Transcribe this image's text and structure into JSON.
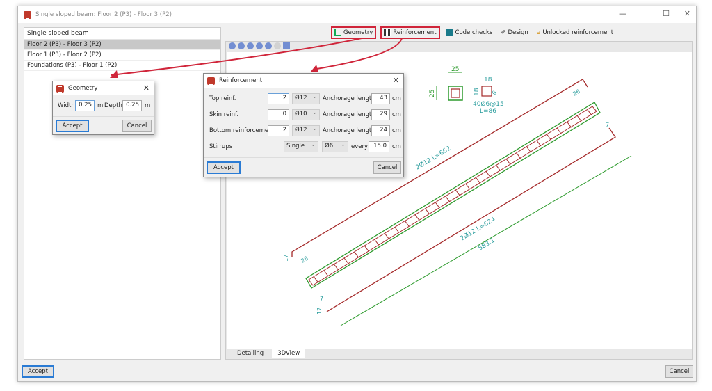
{
  "window": {
    "title": "Single sloped beam: Floor 2 (P3) - Floor 3 (P2)"
  },
  "left_panel": {
    "header": "Single sloped beam",
    "items": [
      "Floor 2 (P3) - Floor 3 (P2)",
      "Floor 1 (P3) - Floor 2 (P2)",
      "Foundations (P3) - Floor 1 (P2)"
    ]
  },
  "toolbar": {
    "geometry": "Geometry",
    "reinforcement": "Reinforcement",
    "code_checks": "Code checks",
    "design": "Design",
    "unlocked": "Unlocked reinforcement"
  },
  "view_tabs": [
    "Detailing",
    "3DView"
  ],
  "footer": {
    "accept": "Accept",
    "cancel": "Cancel"
  },
  "geometry_dialog": {
    "title": "Geometry",
    "width_label": "Width",
    "width": "0.25",
    "unit1": "m",
    "depth_label": "Depth",
    "depth": "0.25",
    "unit2": "m",
    "accept": "Accept",
    "cancel": "Cancel"
  },
  "reinforcement_dialog": {
    "title": "Reinforcement",
    "rows": [
      {
        "label": "Top reinf.",
        "count": "2",
        "dia": "Ø12",
        "anch_label": "Anchorage length",
        "anch": "43",
        "unit": "cm"
      },
      {
        "label": "Skin reinf.",
        "count": "0",
        "dia": "Ø10",
        "anch_label": "Anchorage length",
        "anch": "29",
        "unit": "cm"
      },
      {
        "label": "Bottom reinforcement",
        "count": "2",
        "dia": "Ø12",
        "anch_label": "Anchorage length",
        "anch": "24",
        "unit": "cm"
      }
    ],
    "stirrups": {
      "label": "Stirrups",
      "type": "Single",
      "dia": "Ø6",
      "every_label": "every",
      "spacing": "15.0",
      "unit": "cm"
    },
    "accept": "Accept",
    "cancel": "Cancel"
  },
  "drawing": {
    "section_width": "25",
    "section_depth": "25",
    "stirrup_w": "18",
    "stirrup_h": "18",
    "hook": "6",
    "stirrup_label": "40Ø6@15",
    "stirrup_len": "L=86",
    "top_bar": "2Ø12 L=662",
    "bottom_bar": "2Ø12 L=624",
    "length": "583.1",
    "top_anch": "26",
    "top_anch2": "26",
    "bot_hook": "7",
    "bot_hook2": "7",
    "top_hook": "17",
    "bot_hook3": "17",
    "stirrup_count": 28
  },
  "colors": {
    "accent": "#d0253a",
    "rebar": "#a52a2a",
    "concrete": "#2e9b2e",
    "dim": "#2a9d9d"
  }
}
